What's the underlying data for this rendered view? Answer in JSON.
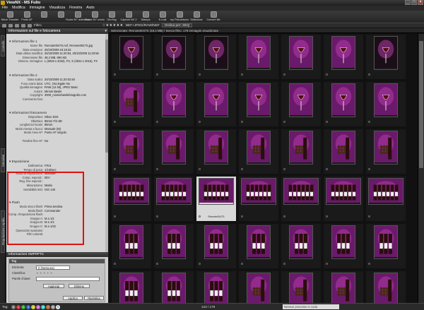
{
  "window": {
    "title": "ViewNX - MS Fulto",
    "buttons": [
      "_",
      "□",
      "×"
    ]
  },
  "menu": [
    "File",
    "Modifica",
    "Immagine",
    "Visualizza",
    "Finestra",
    "Aiuto"
  ],
  "toolbar": [
    "Nikon Transfer",
    "Punto AF",
    "",
    "",
    "Ruota 90° antiorario",
    "Ruota 90° orario",
    "GeoTag",
    "Capture NX 2",
    "Stampa",
    "E-mail",
    "my Picturetown",
    "Slideshow",
    "Convert file"
  ],
  "subbar": {
    "filter": "Filtro",
    "stars": "☆★★★★★",
    "format": "NEF+JPEG/RAW/NEF",
    "sort": "Ordina per: SEQ"
  },
  "side_tabs": [
    "Cartelle",
    "Metadati",
    "Regolazione rapida"
  ],
  "panel": {
    "title": "Informazioni sul file e fotocamera",
    "sections": [
      {
        "title": "Informazioni file 1",
        "rows": [
          [
            "Nome file:",
            "Remote0047S.nef, Remote0047S.jpg"
          ],
          [
            "Data creazione:",
            "20/10/2009 15:15:32"
          ],
          [
            "Data ultima modifica:",
            "20/10/2009 11:20:54, 20/10/2009 11:20:56"
          ],
          [
            "Dimensione file:",
            "48,4 MB, 894 KB"
          ],
          [
            "Dimens. immagine:",
            "L (6048 x 4032), FX, S (3024 x 2016), FX"
          ]
        ]
      },
      {
        "title": "Informazioni file 2",
        "rows": [
          [
            "Data scatto:",
            "20/10/2009 11:20:02.50"
          ],
          [
            "Fuso orario data:",
            "UTC, Ora legale No"
          ],
          [
            "Qualità immagine:",
            "RAW (14 bit), JPEG Basic"
          ],
          [
            "Autore:",
            "Minnie Basile"
          ],
          [
            "Copyright:",
            "2009_minniebasilefotografo.com"
          ],
          [
            "Commento foto:",
            ""
          ]
        ]
      },
      {
        "title": "Informazioni fotocamera",
        "rows": [
          [
            "Dispositivo:",
            "Nikon D3X"
          ],
          [
            "Obiettivo:",
            "85mm F/2.8D"
          ],
          [
            "Lunghezza focale:",
            "85mm"
          ],
          [
            "Modo messa a fuoco:",
            "Manuale (M)"
          ],
          [
            "Modo Area AF:",
            "Punto AF singolo"
          ],
          [
            "",
            ""
          ],
          [
            "Tendine fine AF:",
            "No"
          ]
        ]
      },
      {
        "title": "Esposizione",
        "rows": [
          [
            "Diaframma:",
            "F/8.5"
          ],
          [
            "Tempo di posa:",
            "1/160sec"
          ],
          [
            "Modo di esposizione:",
            "Manuale"
          ],
          [
            "Comp. esposiz.:",
            "0EV"
          ],
          [
            "Reg. fine esposiz.:",
            ""
          ],
          [
            "Misurazione:",
            "Matrix"
          ],
          [
            "Sensibilità ISO:",
            "ISO 140"
          ]
        ]
      },
      {
        "title": "Flash",
        "rows": [
          [
            "Modo sincro flash:",
            "Prima tendina"
          ],
          [
            "Modo flash:",
            "Commander"
          ],
          [
            "Comp. d'esposizione flash:",
            ""
          ],
          [
            "Gruppo A:",
            "M a 1/2"
          ],
          [
            "Gruppo B:",
            "M a 1/4"
          ],
          [
            "Gruppo C:",
            "M a 1/32"
          ],
          [
            "Operazioni avanzate:",
            ""
          ],
          [
            "Filtri colorati:",
            ""
          ]
        ]
      }
    ]
  },
  "xmp": {
    "title": "Informazioni XMP/IPTC",
    "tag_title": "Tag",
    "etichetta_label": "Etichetta:",
    "etichetta_value": "0 (Nessuna)",
    "classifica_label": "Classifica:",
    "classifica_value": "★ ★ ★ ★ ★",
    "parole_label": "Parole chiave:",
    "add_button": "Aggiungi",
    "delete_button": "Elimina",
    "apply_button": "Applica",
    "reset_button": "Ripristina"
  },
  "viewer": {
    "info": "Selezionate: Remote0047S (48,3 MB) / Senza filtro: 179 immagini visualizzate",
    "selected_label": "Remote0047S"
  },
  "status": {
    "tag_label": "Tag:",
    "page": "123 / 179",
    "queue": "Nessun processo in coda"
  },
  "tag_chips": [
    "0",
    "1",
    "2",
    "3",
    "4",
    "5",
    "6",
    "7",
    "8",
    "9"
  ],
  "colors": {
    "selection_highlight": "#e01010",
    "bg_dark": "#111111",
    "panel_bg": "#d4d4d4",
    "purple": "#7a1f7a",
    "magenta": "#c13bb8"
  }
}
